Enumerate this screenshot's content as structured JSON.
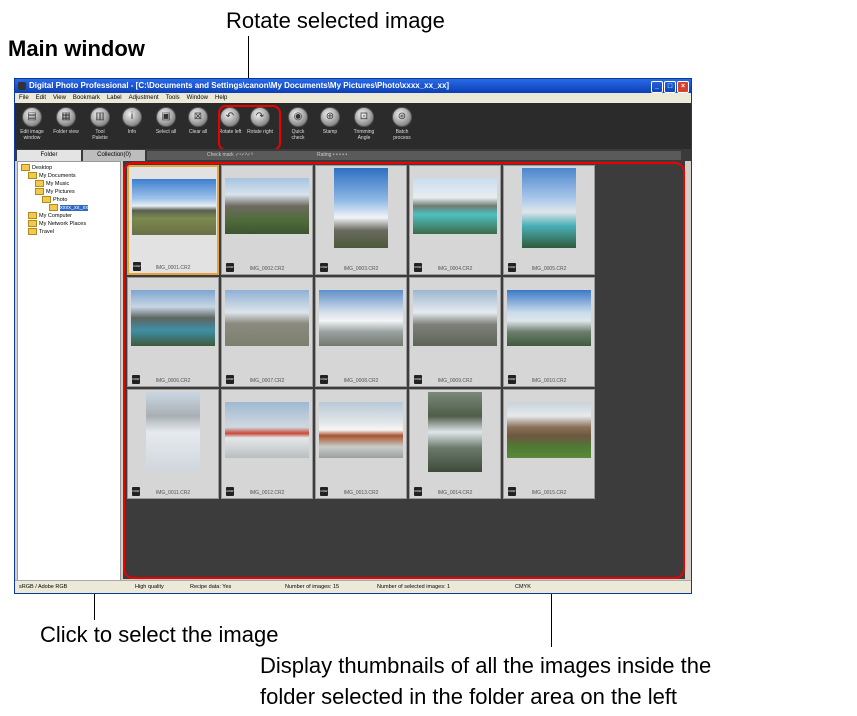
{
  "annotations": {
    "main_window": "Main window",
    "rotate": "Rotate selected image",
    "click_select": "Click to select the image",
    "display_line1": "Display thumbnails of all the images inside the",
    "display_line2": "folder selected in the folder area on the left"
  },
  "window": {
    "title": "Digital Photo Professional - [C:\\Documents and Settings\\canon\\My Documents\\My Pictures\\Photo\\xxxx_xx_xx]",
    "minimize": "_",
    "maximize": "□",
    "close": "×"
  },
  "menu": [
    "File",
    "Edit",
    "View",
    "Bookmark",
    "Label",
    "Adjustment",
    "Tools",
    "Window",
    "Help"
  ],
  "toolbar": [
    {
      "label": "Edit image window",
      "icon": "edit-image-icon",
      "glyph": "▤"
    },
    {
      "label": "Folder view",
      "icon": "folder-view-icon",
      "glyph": "▦"
    },
    {
      "label": "Tool Palette",
      "icon": "tool-palette-icon",
      "glyph": "▥"
    },
    {
      "label": "Info",
      "icon": "info-icon",
      "glyph": "i"
    },
    {
      "label": "Select all",
      "icon": "select-all-icon",
      "glyph": "▣"
    },
    {
      "label": "Clear all",
      "icon": "clear-all-icon",
      "glyph": "⊠"
    },
    {
      "label": "Rotate left",
      "icon": "rotate-left-icon",
      "glyph": "↶"
    },
    {
      "label": "Rotate right",
      "icon": "rotate-right-icon",
      "glyph": "↷"
    },
    {
      "label": "Quick check",
      "icon": "quick-check-icon",
      "glyph": "◉"
    },
    {
      "label": "Stamp",
      "icon": "stamp-icon",
      "glyph": "⊕"
    },
    {
      "label": "Trimming Angle",
      "icon": "trimming-angle-icon",
      "glyph": "⊡"
    },
    {
      "label": "Batch process",
      "icon": "batch-process-icon",
      "glyph": "⊛"
    }
  ],
  "tabs": {
    "folder": "Folder",
    "collection": "Collection(0)"
  },
  "filter": {
    "check_mark": "Check mark",
    "rating": "Rating"
  },
  "tree": [
    {
      "label": "Desktop",
      "level": 0
    },
    {
      "label": "My Documents",
      "level": 1
    },
    {
      "label": "My Music",
      "level": 2
    },
    {
      "label": "My Pictures",
      "level": 2
    },
    {
      "label": "Photo",
      "level": 3
    },
    {
      "label": "xxxx_xx_xx",
      "level": 4,
      "selected": true
    },
    {
      "label": "My Computer",
      "level": 1
    },
    {
      "label": "My Network Places",
      "level": 1
    },
    {
      "label": "Travel",
      "level": 1
    }
  ],
  "raw_badge": "RAW",
  "thumbnails": [
    {
      "name": "IMG_0001.CR2",
      "selected": true
    },
    {
      "name": "IMG_0002.CR2"
    },
    {
      "name": "IMG_0003.CR2"
    },
    {
      "name": "IMG_0004.CR2"
    },
    {
      "name": "IMG_0005.CR2"
    },
    {
      "name": "IMG_0006.CR2"
    },
    {
      "name": "IMG_0007.CR2"
    },
    {
      "name": "IMG_0008.CR2"
    },
    {
      "name": "IMG_0009.CR2"
    },
    {
      "name": "IMG_0010.CR2"
    },
    {
      "name": "IMG_0011.CR2"
    },
    {
      "name": "IMG_0012.CR2"
    },
    {
      "name": "IMG_0013.CR2"
    },
    {
      "name": "IMG_0014.CR2"
    },
    {
      "name": "IMG_0015.CR2"
    }
  ],
  "status": {
    "color_space": "sRGB / Adobe RGB",
    "quality": "High quality",
    "recipe": "Recipe data: Yes",
    "num_images": "Number of images: 15",
    "num_selected": "Number of selected images: 1",
    "cmyk": "CMYK"
  },
  "colors": {
    "highlight": "#e00000",
    "selection": "#e8a23a",
    "grid_bg": "#3c3c3c"
  }
}
